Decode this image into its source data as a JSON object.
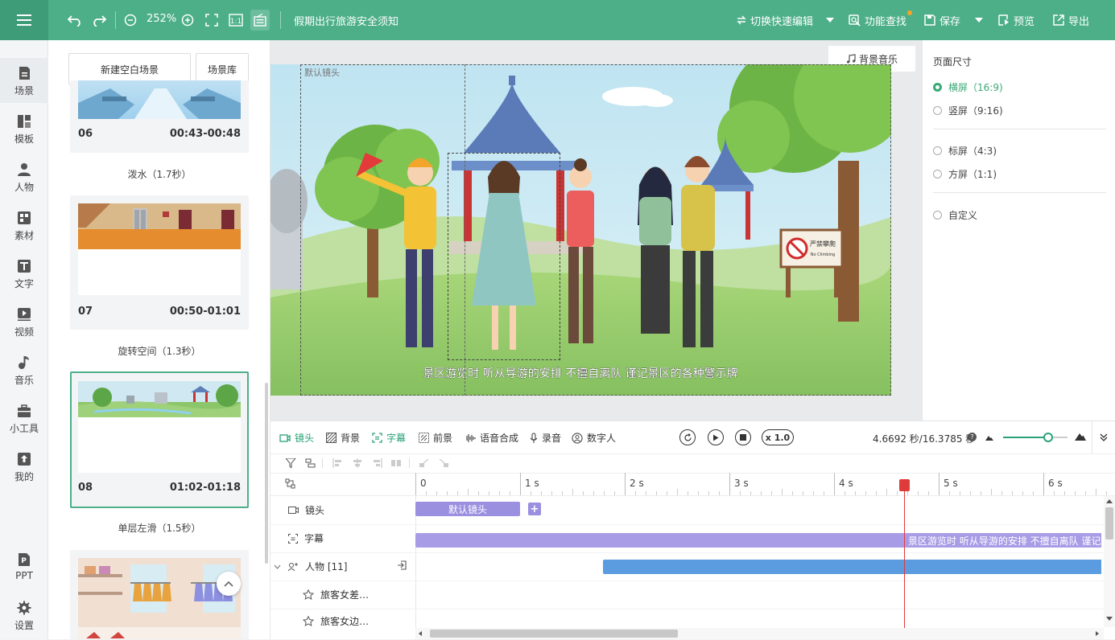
{
  "topbar": {
    "zoom": "252%",
    "project_title": "假期出行旅游安全须知",
    "switch_edit": "切换快速编辑",
    "feature_search": "功能查找",
    "save": "保存",
    "preview": "预览",
    "export": "导出"
  },
  "nav": [
    {
      "label": "场景",
      "icon": "scene-icon"
    },
    {
      "label": "模板",
      "icon": "template-icon"
    },
    {
      "label": "人物",
      "icon": "person-icon"
    },
    {
      "label": "素材",
      "icon": "material-icon"
    },
    {
      "label": "文字",
      "icon": "text-icon"
    },
    {
      "label": "视频",
      "icon": "video-icon"
    },
    {
      "label": "音乐",
      "icon": "music-icon"
    },
    {
      "label": "小工具",
      "icon": "toolbox-icon"
    },
    {
      "label": "我的",
      "icon": "upload-icon"
    },
    {
      "label": "PPT",
      "icon": "ppt-icon"
    },
    {
      "label": "设置",
      "icon": "gear-icon"
    }
  ],
  "scene_panel": {
    "new_blank": "新建空白场景",
    "library": "场景库",
    "scenes": [
      {
        "num": "06",
        "time": "00:43-00:48",
        "transition": "泼水（1.7秒）"
      },
      {
        "num": "07",
        "time": "00:50-01:01",
        "transition": "旋转空间（1.3秒）"
      },
      {
        "num": "08",
        "time": "01:02-01:18",
        "transition": "单层左滑（1.5秒）"
      }
    ]
  },
  "canvas": {
    "bg_music": "背景音乐",
    "camera_label": "默认镜头",
    "subtitle": "景区游览时 听从导游的安排 不擅自离队 谨记景区的各种警示牌",
    "sign_title": "严禁攀爬",
    "sign_sub": "No Climbing"
  },
  "props": {
    "title": "页面尺寸",
    "options": [
      "横屏（16:9)",
      "竖屏（9:16)",
      "标屏（4:3)",
      "方屏（1:1)",
      "自定义"
    ],
    "selected": 0
  },
  "timeline": {
    "tabs": [
      "镜头",
      "背景",
      "字幕",
      "前景",
      "语音合成",
      "录音",
      "数字人"
    ],
    "active_tab": 2,
    "speed": "x 1.0",
    "time_readout": "4.6692 秒/16.3785 秒",
    "ruler": [
      "0",
      "1 s",
      "2 s",
      "3 s",
      "4 s",
      "5 s",
      "6 s"
    ],
    "playhead_seconds": 4.6692,
    "tracks": {
      "camera": "镜头",
      "camera_clip": "默认镜头",
      "subtitle": "字幕",
      "subtitle_clip": "景区游览时 听从导游的安排 不擅自离队 谨记景区的各种警示牌",
      "people": "人物 [11]",
      "person1": "旅客女差…",
      "person2": "旅客女边…"
    }
  },
  "colors": {
    "accent": "#4caf88",
    "clip_purple": "#9b8fe0",
    "clip_blue": "#5b9be0",
    "playhead": "#e03b3b"
  }
}
